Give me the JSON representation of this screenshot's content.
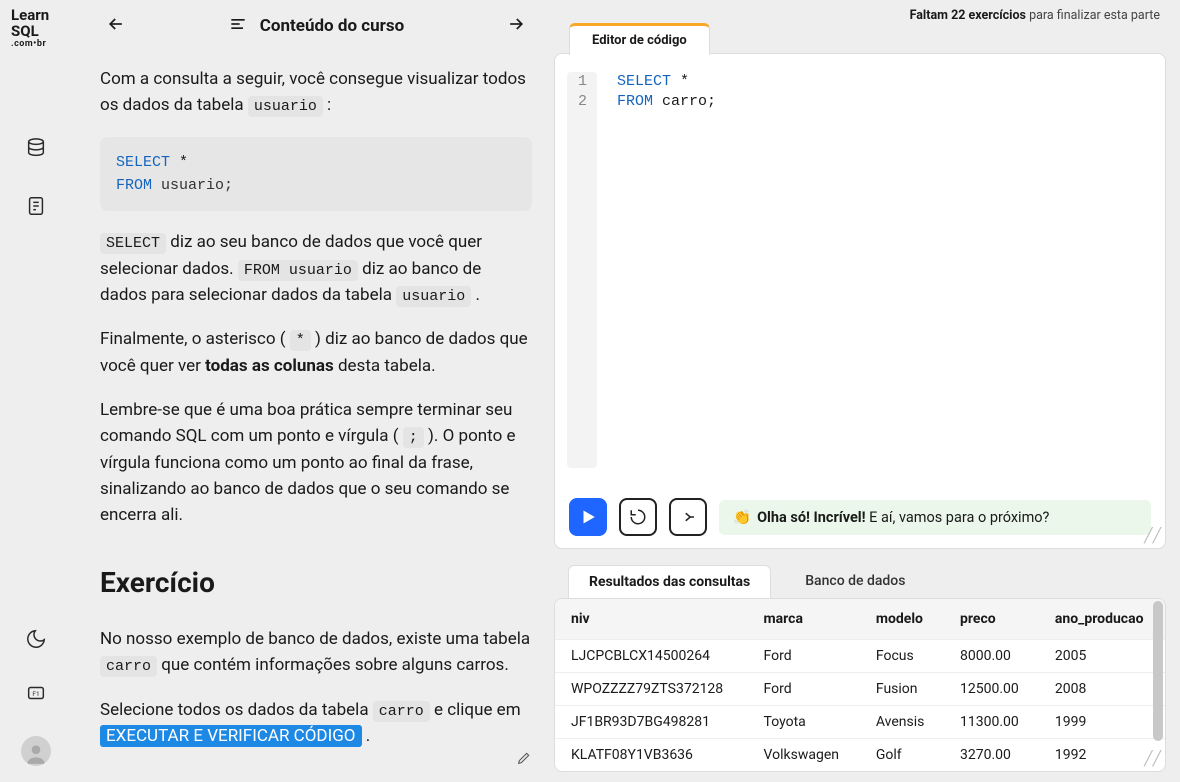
{
  "logo": {
    "line1": "Learn",
    "line2": "SQL",
    "line3": ".com•br"
  },
  "header": {
    "title": "Conteúdo do curso"
  },
  "top_note": {
    "bold": "Faltam 22 exercícios",
    "rest": " para finalizar esta parte"
  },
  "lesson": {
    "p1_a": "Com a consulta a seguir, você consegue visualizar todos os dados da tabela ",
    "p1_code": "usuario",
    "p1_b": " :",
    "sql1_kw1": "SELECT",
    "sql1_star": " *",
    "sql1_kw2": "FROM",
    "sql1_id": " usuario;",
    "p2_code1": "SELECT",
    "p2_a": " diz ao seu banco de dados que você quer selecionar dados. ",
    "p2_code2": "FROM usuario",
    "p2_b": " diz ao banco de dados para selecionar dados da tabela ",
    "p2_code3": "usuario",
    "p2_c": " .",
    "p3_a": "Finalmente, o asterisco ( ",
    "p3_code": "*",
    "p3_b": " ) diz ao banco de dados que você quer ver ",
    "p3_bold": "todas as colunas",
    "p3_c": " desta tabela.",
    "p4_a": "Lembre-se que é uma boa prática sempre terminar seu comando SQL com um ponto e vírgula ( ",
    "p4_code": ";",
    "p4_b": " ). O ponto e vírgula funciona como um ponto ao final da frase, sinalizando ao banco de dados que o seu comando se encerra ali.",
    "h2": "Exercício",
    "p5_a": "No nosso exemplo de banco de dados, existe uma tabela ",
    "p5_code": "carro",
    "p5_b": " que contém informações sobre alguns carros.",
    "p6_a": "Selecione todos os dados da tabela ",
    "p6_code": "carro",
    "p6_b": " e clique em ",
    "p6_btn": "EXECUTAR E VERIFICAR CÓDIGO",
    "p6_c": " ."
  },
  "editor": {
    "tab_label": "Editor de código",
    "line_numbers": [
      "1",
      "2"
    ],
    "code_l1_kw": "SELECT",
    "code_l1_rest": " *",
    "code_l2_kw": "FROM",
    "code_l2_rest": " carro;"
  },
  "toast": {
    "emoji": "👏",
    "bold": "Olha só! Incrível!",
    "rest": " E aí, vamos para o próximo?"
  },
  "results": {
    "tab_active": "Resultados das consultas",
    "tab_inactive": "Banco de dados",
    "columns": [
      "niv",
      "marca",
      "modelo",
      "preco",
      "ano_producao"
    ],
    "rows": [
      [
        "LJCPCBLCX14500264",
        "Ford",
        "Focus",
        "8000.00",
        "2005"
      ],
      [
        "WPOZZZZ79ZTS372128",
        "Ford",
        "Fusion",
        "12500.00",
        "2008"
      ],
      [
        "JF1BR93D7BG498281",
        "Toyota",
        "Avensis",
        "11300.00",
        "1999"
      ],
      [
        "KLATF08Y1VB3636",
        "Volkswagen",
        "Golf",
        "3270.00",
        "1992"
      ]
    ]
  }
}
